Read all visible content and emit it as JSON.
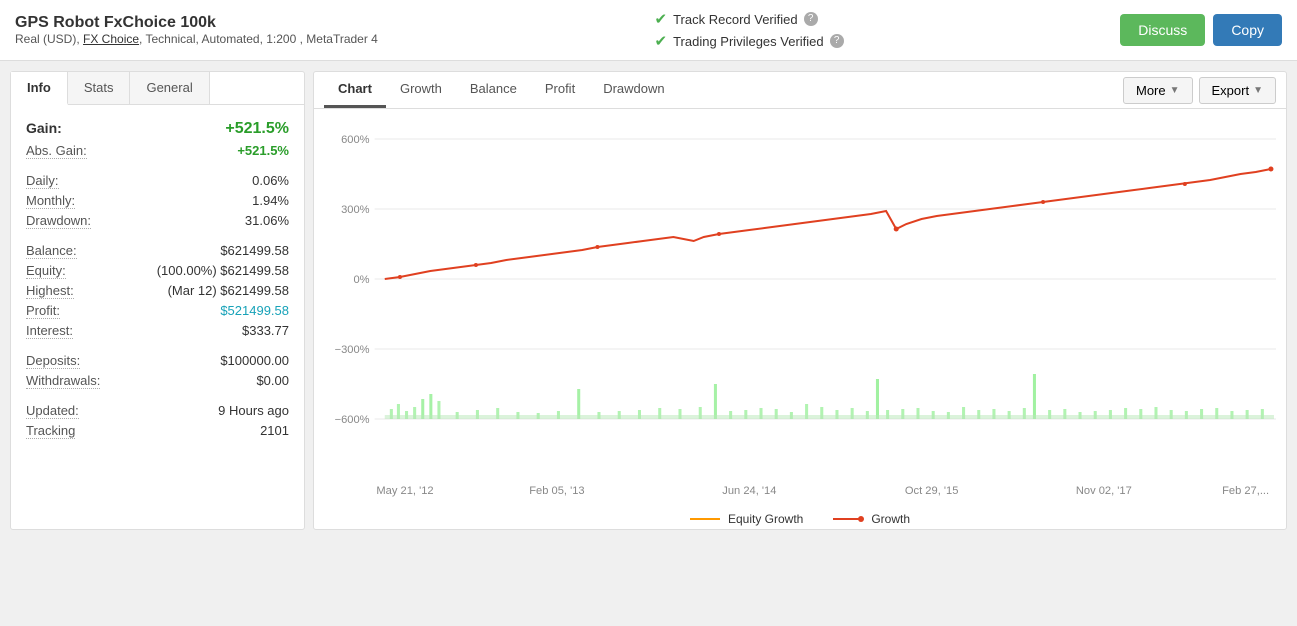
{
  "header": {
    "title": "GPS Robot FxChoice 100k",
    "subtitle": "Real (USD), FX Choice, Technical, Automated, 1:200 , MetaTrader 4",
    "fx_choice_link": "FX Choice",
    "verified1": "Track Record Verified",
    "verified2": "Trading Privileges Verified",
    "btn_discuss": "Discuss",
    "btn_copy": "Copy"
  },
  "left_panel": {
    "tabs": [
      "Info",
      "Stats",
      "General"
    ],
    "active_tab": "Info",
    "gain_label": "Gain:",
    "gain_value": "+521.5%",
    "rows": [
      {
        "label": "Abs. Gain:",
        "value": "+521.5%",
        "style": "green",
        "dotted": true
      },
      {
        "label": "Daily:",
        "value": "0.06%",
        "style": "normal"
      },
      {
        "label": "Monthly:",
        "value": "1.94%",
        "style": "normal",
        "dotted": true
      },
      {
        "label": "Drawdown:",
        "value": "31.06%",
        "style": "normal"
      },
      {
        "label": "Balance:",
        "value": "$621499.58",
        "style": "normal"
      },
      {
        "label": "Equity:",
        "value": "(100.00%) $621499.58",
        "style": "normal"
      },
      {
        "label": "Highest:",
        "value": "(Mar 12) $621499.58",
        "style": "normal"
      },
      {
        "label": "Profit:",
        "value": "$521499.58",
        "style": "teal"
      },
      {
        "label": "Interest:",
        "value": "$333.77",
        "style": "normal"
      },
      {
        "label": "Deposits:",
        "value": "$100000.00",
        "style": "normal"
      },
      {
        "label": "Withdrawals:",
        "value": "$0.00",
        "style": "normal"
      },
      {
        "label": "Updated:",
        "value": "9 Hours ago",
        "style": "normal"
      },
      {
        "label": "Tracking",
        "value": "2101",
        "style": "normal"
      }
    ]
  },
  "right_panel": {
    "tabs": [
      "Chart",
      "Growth",
      "Balance",
      "Profit",
      "Drawdown"
    ],
    "active_tab": "Chart",
    "toolbar_more": "More",
    "toolbar_export": "Export",
    "x_labels": [
      "May 21, '12",
      "Feb 05, '13",
      "Jun 24, '14",
      "Oct 29, '15",
      "Nov 02, '17",
      "Feb 27,..."
    ],
    "y_labels": [
      "600%",
      "300%",
      "0%",
      "-300%",
      "-600%"
    ],
    "legend": {
      "equity_label": "Equity Growth",
      "growth_label": "Growth"
    }
  }
}
